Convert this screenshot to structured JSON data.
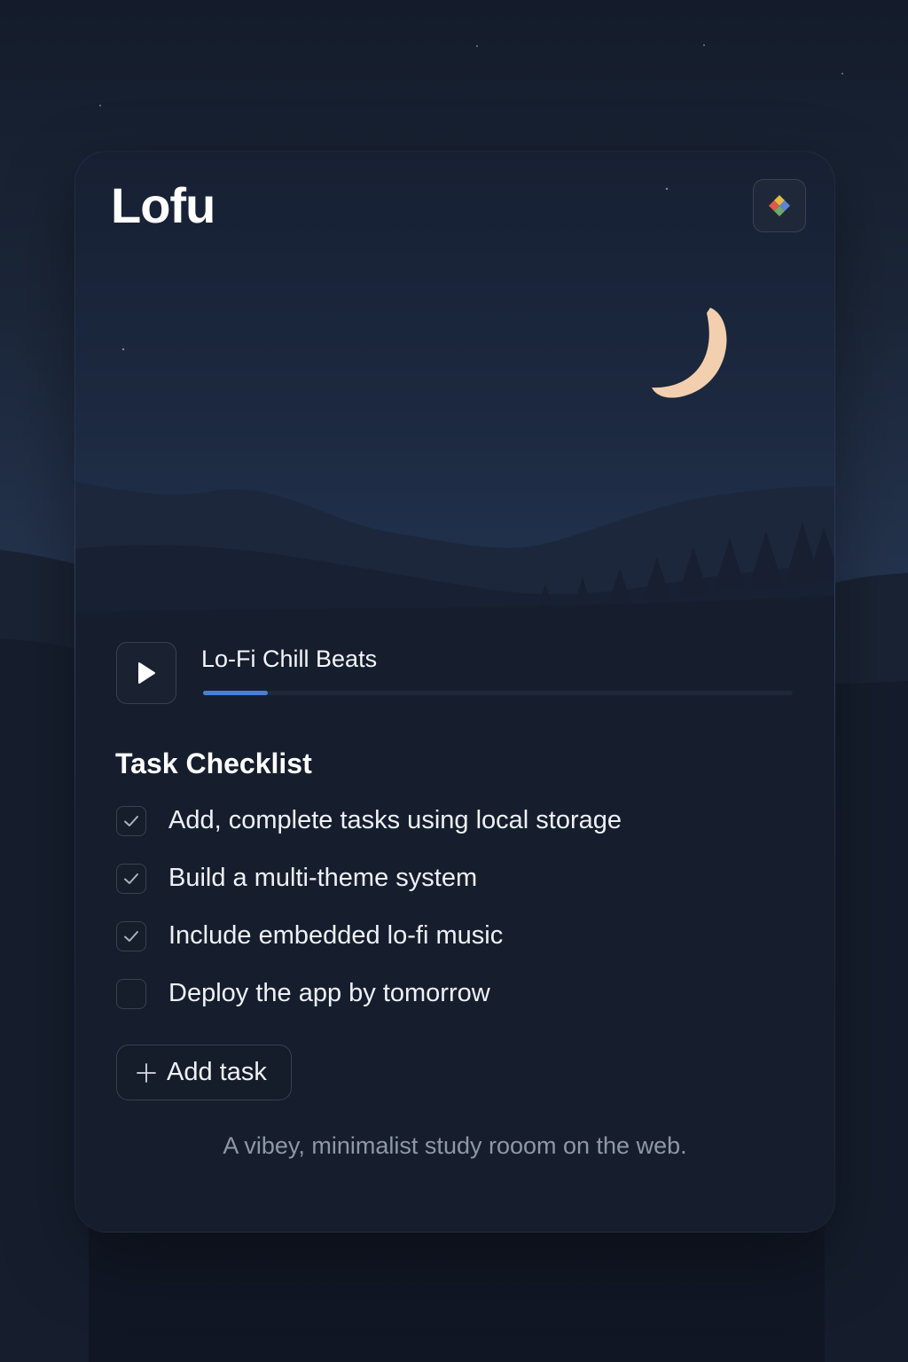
{
  "app": {
    "title": "Lofu",
    "theme_button_icon": "palette-diamond-icon"
  },
  "player": {
    "play_icon": "play-icon",
    "track_title": "Lo-Fi Chill Beats",
    "progress_fraction": 0.11,
    "accent_color": "#4b7fd6"
  },
  "checklist": {
    "title": "Task Checklist",
    "tasks": [
      {
        "label": "Add, complete tasks using local storage",
        "done": true
      },
      {
        "label": "Build a multi-theme system",
        "done": true
      },
      {
        "label": "Include embedded lo-fi music",
        "done": true
      },
      {
        "label": "Deploy the app by tomorrow",
        "done": false
      }
    ],
    "add_icon": "plus-icon",
    "add_label": "Add task"
  },
  "footer": {
    "tagline": "A vibey, minimalist study rooom on the web."
  },
  "colors": {
    "moon": "#f2cfae",
    "card_background": "#1c2940",
    "page_background": "#141c2b"
  }
}
